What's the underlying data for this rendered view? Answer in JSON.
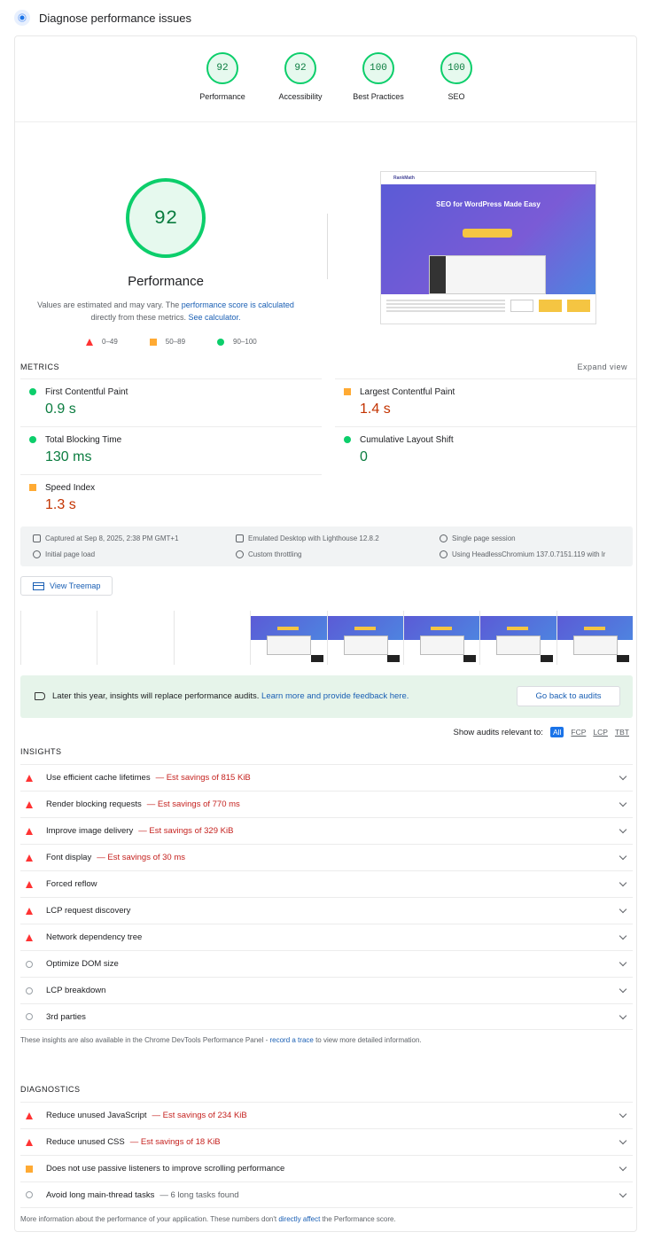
{
  "header": {
    "title": "Diagnose performance issues"
  },
  "categories": [
    {
      "score": "92",
      "label": "Performance"
    },
    {
      "score": "92",
      "label": "Accessibility"
    },
    {
      "score": "100",
      "label": "Best Practices"
    },
    {
      "score": "100",
      "label": "SEO"
    }
  ],
  "performance": {
    "score": "92",
    "label": "Performance",
    "note_1": "Values are estimated and may vary. The ",
    "note_link_1": "performance score is calculated",
    "note_2": " directly from these metrics. ",
    "note_link_2": "See calculator."
  },
  "legend": [
    {
      "range": "0–49",
      "color": "#ff3333"
    },
    {
      "range": "50–89",
      "color": "#ffaa33"
    },
    {
      "range": "90–100",
      "color": "#0cce6b"
    }
  ],
  "screenshot": {
    "brand": "RankMath",
    "heading": "SEO for WordPress Made Easy"
  },
  "metrics": {
    "heading": "METRICS",
    "expand": "Expand view",
    "fcp": {
      "name": "First Contentful Paint",
      "value": "0.9 s"
    },
    "lcp": {
      "name": "Largest Contentful Paint",
      "value": "1.4 s"
    },
    "tbt": {
      "name": "Total Blocking Time",
      "value": "130 ms"
    },
    "cls": {
      "name": "Cumulative Layout Shift",
      "value": "0"
    },
    "si": {
      "name": "Speed Index",
      "value": "1.3 s"
    }
  },
  "run_info": {
    "captured": "Captured at Sep 8, 2025, 2:38 PM GMT+1",
    "device": "Emulated Desktop with Lighthouse 12.8.2",
    "session": "Single page session",
    "load": "Initial page load",
    "throttling": "Custom throttling",
    "browser": "Using HeadlessChromium 137.0.7151.119 with lr"
  },
  "treemap": {
    "label": "View Treemap"
  },
  "banner": {
    "text": "Later this year, insights will replace performance audits. ",
    "link": "Learn more and provide feedback here.",
    "button": "Go back to audits"
  },
  "filter": {
    "label": "Show audits relevant to:",
    "chips": [
      "All",
      "FCP",
      "LCP",
      "TBT"
    ]
  },
  "insights": {
    "heading": "INSIGHTS",
    "items": [
      {
        "name": "Use efficient cache lifetimes",
        "savings": "— Est savings of 815 KiB"
      },
      {
        "name": "Render blocking requests",
        "savings": "— Est savings of 770 ms"
      },
      {
        "name": "Improve image delivery",
        "savings": "— Est savings of 329 KiB"
      },
      {
        "name": "Font display",
        "savings": "— Est savings of 30 ms"
      },
      {
        "name": "Forced reflow",
        "savings": ""
      },
      {
        "name": "LCP request discovery",
        "savings": ""
      },
      {
        "name": "Network dependency tree",
        "savings": ""
      },
      {
        "name": "Optimize DOM size",
        "savings": ""
      },
      {
        "name": "LCP breakdown",
        "savings": ""
      },
      {
        "name": "3rd parties",
        "savings": ""
      }
    ],
    "note_1": "These insights are also available in the Chrome DevTools Performance Panel - ",
    "note_link": "record a trace",
    "note_2": " to view more detailed information."
  },
  "diagnostics": {
    "heading": "DIAGNOSTICS",
    "items": [
      {
        "name": "Reduce unused JavaScript",
        "savings": "— Est savings of 234 KiB"
      },
      {
        "name": "Reduce unused CSS",
        "savings": "— Est savings of 18 KiB"
      },
      {
        "name": "Does not use passive listeners to improve scrolling performance",
        "savings": ""
      },
      {
        "name": "Avoid long main-thread tasks",
        "savings": "— 6 long tasks found"
      }
    ],
    "note_1": "More information about the performance of your application. These numbers don't ",
    "note_link": "directly affect",
    "note_2": " the Performance score."
  }
}
